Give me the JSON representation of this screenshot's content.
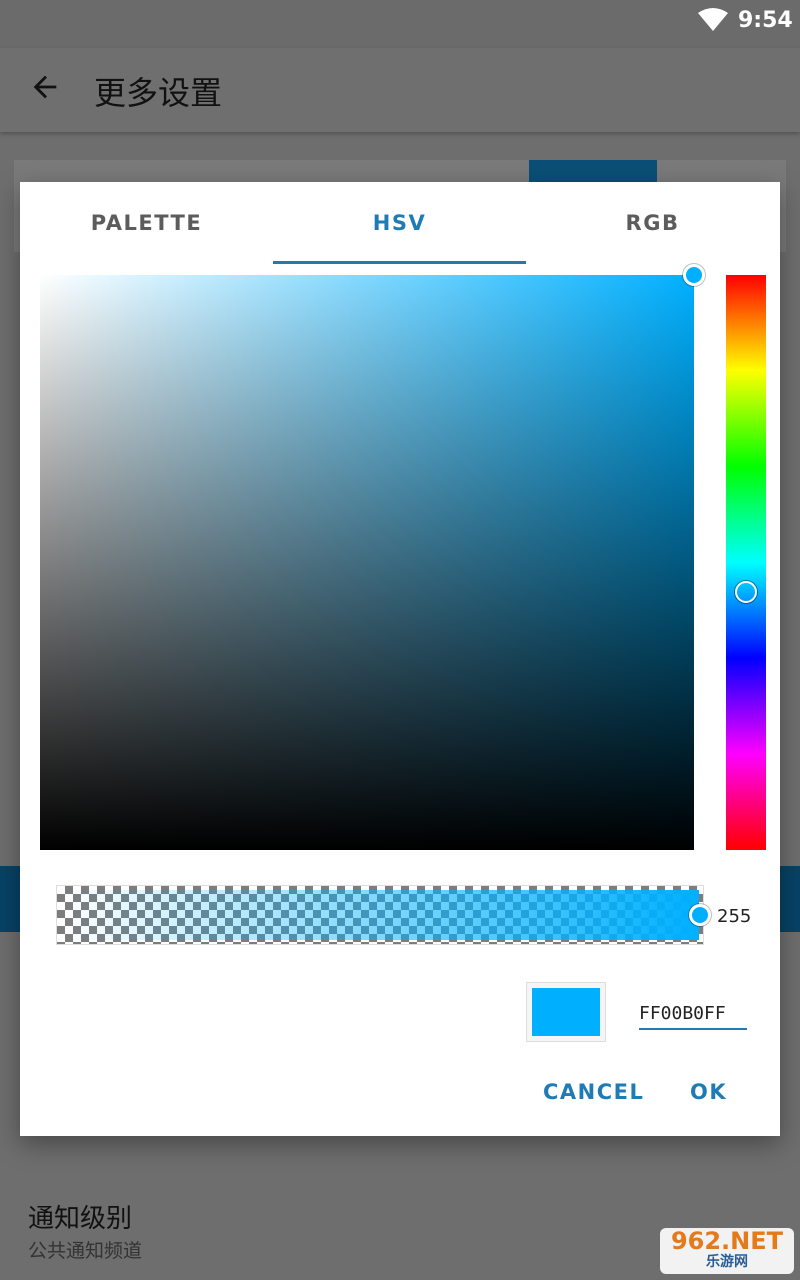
{
  "status_bar": {
    "time": "9:54",
    "wifi_icon": "wifi-icon"
  },
  "app_bar": {
    "title": "更多设置",
    "back_icon": "arrow-left-icon"
  },
  "background_list": {
    "item_title": "通知级别",
    "item_subtitle": "公共通知频道"
  },
  "watermark": {
    "main": "962.NET",
    "sub": "乐游网"
  },
  "dialog": {
    "tabs": [
      {
        "label": "PALETTE",
        "active": false
      },
      {
        "label": "HSV",
        "active": true
      },
      {
        "label": "RGB",
        "active": false
      }
    ],
    "hue_color": "#00b0ff",
    "alpha_value": "255",
    "hex_value": "FF00B0FF",
    "selected_color": "#00b0ff",
    "accent_color": "#1f7bb5",
    "cancel_label": "CANCEL",
    "ok_label": "OK"
  }
}
